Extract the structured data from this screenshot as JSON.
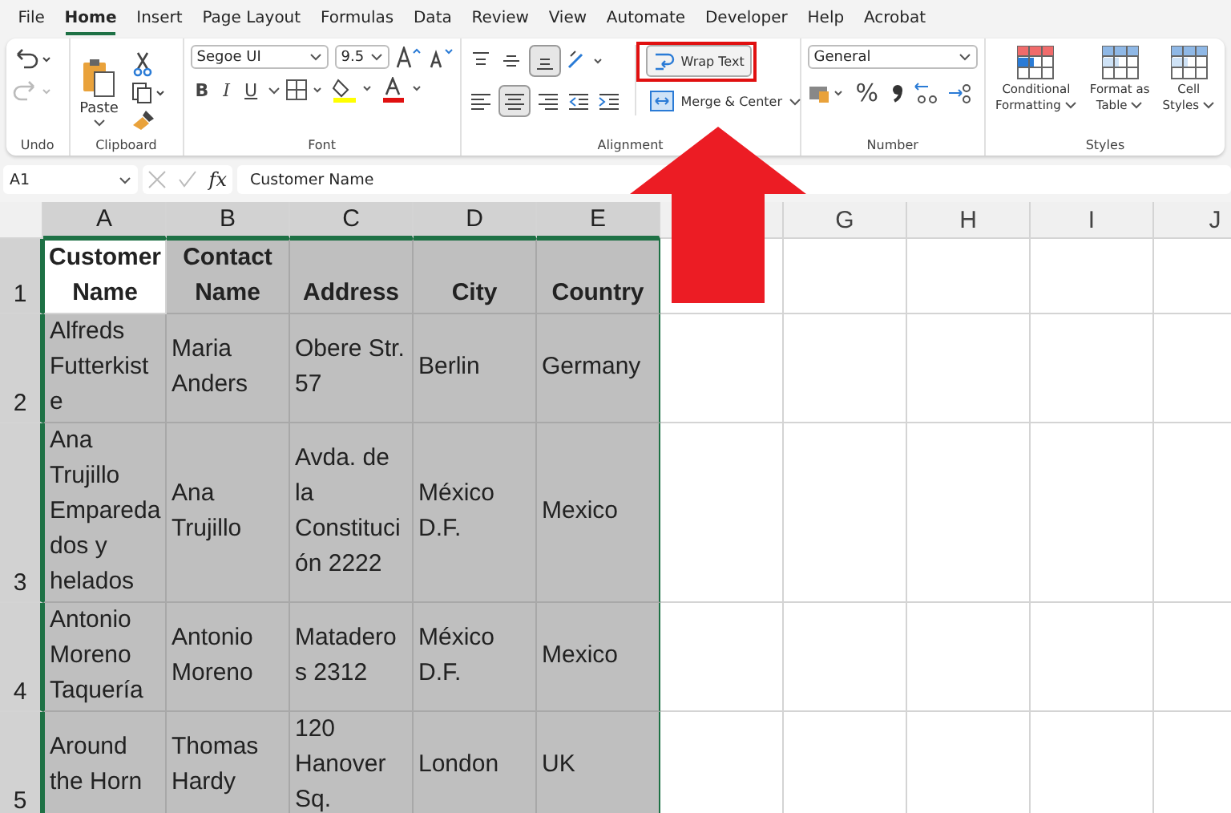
{
  "menu_tabs": [
    {
      "label": "File",
      "selected": false
    },
    {
      "label": "Home",
      "selected": true
    },
    {
      "label": "Insert",
      "selected": false
    },
    {
      "label": "Page Layout",
      "selected": false
    },
    {
      "label": "Formulas",
      "selected": false
    },
    {
      "label": "Data",
      "selected": false
    },
    {
      "label": "Review",
      "selected": false
    },
    {
      "label": "View",
      "selected": false
    },
    {
      "label": "Automate",
      "selected": false
    },
    {
      "label": "Developer",
      "selected": false
    },
    {
      "label": "Help",
      "selected": false
    },
    {
      "label": "Acrobat",
      "selected": false
    }
  ],
  "ribbon": {
    "undo": {
      "label": "Undo"
    },
    "clipboard": {
      "paste": "Paste",
      "label": "Clipboard"
    },
    "font": {
      "family": "Segoe UI",
      "size": "9.5",
      "bold": "B",
      "italic": "I",
      "underline": "U",
      "label": "Font"
    },
    "alignment": {
      "wrap_text": "Wrap Text",
      "merge": "Merge & Center",
      "label": "Alignment"
    },
    "number": {
      "format": "General",
      "percent": "%",
      "label": "Number"
    },
    "styles": {
      "buttons": [
        {
          "lines": [
            "Conditional",
            "Formatting"
          ]
        },
        {
          "lines": [
            "Format as",
            "Table"
          ]
        },
        {
          "lines": [
            "Cell",
            "Styles"
          ]
        }
      ],
      "label": "Styles"
    }
  },
  "formula_bar": {
    "name_box": "A1",
    "fx": "fx",
    "value": "Customer Name"
  },
  "sheet": {
    "columns": [
      {
        "label": "A",
        "selected": true
      },
      {
        "label": "B",
        "selected": true
      },
      {
        "label": "C",
        "selected": true
      },
      {
        "label": "D",
        "selected": true
      },
      {
        "label": "E",
        "selected": true
      },
      {
        "selected": false
      },
      {
        "label": "G",
        "selected": false
      },
      {
        "label": "H",
        "selected": false
      },
      {
        "label": "I",
        "selected": false
      },
      {
        "label": "J",
        "selected": false
      }
    ],
    "rows": [
      {
        "number": "1",
        "selected": true,
        "cells": [
          {
            "lines": [
              "Customer",
              "Name"
            ],
            "bold": true,
            "active": true
          },
          {
            "lines": [
              "Contact",
              "Name"
            ],
            "bold": true,
            "active": false
          },
          {
            "lines": [
              "Address"
            ],
            "bold": true,
            "active": false
          },
          {
            "lines": [
              "City"
            ],
            "bold": true,
            "active": false
          },
          {
            "lines": [
              "Country"
            ],
            "bold": true,
            "active": false
          }
        ]
      },
      {
        "number": "2",
        "selected": true,
        "cells": [
          {
            "lines": [
              "Alfreds",
              "Futterkist",
              "e"
            ],
            "bold": false,
            "active": false
          },
          {
            "lines": [
              "Maria",
              "Anders"
            ],
            "bold": false,
            "active": false
          },
          {
            "lines": [
              "Obere Str.",
              "57"
            ],
            "bold": false,
            "active": false
          },
          {
            "lines": [
              "Berlin"
            ],
            "bold": false,
            "active": false
          },
          {
            "lines": [
              "Germany"
            ],
            "bold": false,
            "active": false
          }
        ]
      },
      {
        "number": "3",
        "selected": true,
        "cells": [
          {
            "lines": [
              "Ana",
              "Trujillo",
              "Empareda",
              "dos y",
              "helados"
            ],
            "bold": false,
            "active": false
          },
          {
            "lines": [
              "Ana",
              "Trujillo"
            ],
            "bold": false,
            "active": false
          },
          {
            "lines": [
              "Avda. de",
              "la",
              "Constituci",
              "ón 2222"
            ],
            "bold": false,
            "active": false
          },
          {
            "lines": [
              "México",
              "D.F."
            ],
            "bold": false,
            "active": false
          },
          {
            "lines": [
              "Mexico"
            ],
            "bold": false,
            "active": false
          }
        ]
      },
      {
        "number": "4",
        "selected": true,
        "cells": [
          {
            "lines": [
              "Antonio",
              "Moreno",
              "Taquería"
            ],
            "bold": false,
            "active": false
          },
          {
            "lines": [
              "Antonio",
              "Moreno"
            ],
            "bold": false,
            "active": false
          },
          {
            "lines": [
              "Matadero",
              "s 2312"
            ],
            "bold": false,
            "active": false
          },
          {
            "lines": [
              "México",
              "D.F."
            ],
            "bold": false,
            "active": false
          },
          {
            "lines": [
              "Mexico"
            ],
            "bold": false,
            "active": false
          }
        ]
      },
      {
        "number": "5",
        "selected": true,
        "cells": [
          {
            "lines": [
              "Around",
              "the Horn"
            ],
            "bold": false,
            "active": false
          },
          {
            "lines": [
              "Thomas",
              "Hardy"
            ],
            "bold": false,
            "active": false
          },
          {
            "lines": [
              "120",
              "Hanover",
              "Sq."
            ],
            "bold": false,
            "active": false
          },
          {
            "lines": [
              "London"
            ],
            "bold": false,
            "active": false
          },
          {
            "lines": [
              "UK"
            ],
            "bold": false,
            "active": false
          }
        ]
      }
    ]
  }
}
